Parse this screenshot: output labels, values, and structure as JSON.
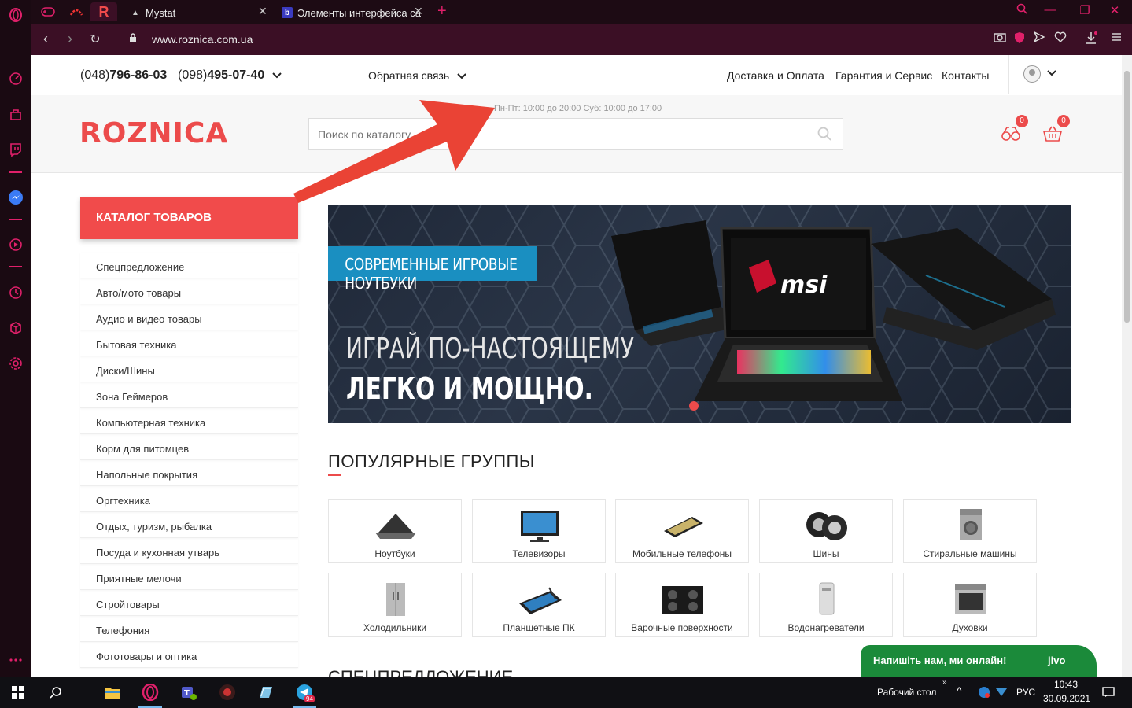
{
  "browser": {
    "tabs": [
      {
        "label": "Mystat"
      },
      {
        "label": "Элементы интерфейса са"
      }
    ],
    "new_tab": "+",
    "url": "www.roznica.com.ua",
    "active_pin": "R"
  },
  "site": {
    "phone1_code": "(048)",
    "phone1_num": "796-86-03",
    "phone2_code": "(098)",
    "phone2_num": "495-07-40",
    "feedback": "Обратная связь",
    "links": [
      "Доставка и Оплата",
      "Гарантия и Сервис",
      "Контакты"
    ],
    "logo": "ROZNICA",
    "hours": "Пн-Пт: 10:00 до 20:00 Суб: 10:00 до 17:00",
    "search_placeholder": "Поиск по каталогу",
    "compare_count": "0",
    "cart_count": "0",
    "catalog_button": "КАТАЛОГ ТОВАРОВ",
    "categories": [
      "Спецпредложение",
      "Авто/мото товары",
      "Аудио и видео товары",
      "Бытовая техника",
      "Диски/Шины",
      "Зона Геймеров",
      "Компьютерная техника",
      "Корм для питомцев",
      "Напольные покрытия",
      "Оргтехника",
      "Отдых, туризм, рыбалка",
      "Посуда и кухонная утварь",
      "Приятные мелочи",
      "Стройтовары",
      "Телефония",
      "Фототовары и оптика"
    ],
    "banner": {
      "ribbon": "СОВРЕМЕННЫЕ ИГРОВЫЕ НОУТБУКИ",
      "line1": "ИГРАЙ ПО-НАСТОЯЩЕМУ",
      "line2": "ЛЕГКО И МОЩНО.",
      "brand": "msi"
    },
    "popular_title": "ПОПУЛЯРНЫЕ ГРУППЫ",
    "groups": [
      "Ноутбуки",
      "Телевизоры",
      "Мобильные телефоны",
      "Шины",
      "Стиральные машины",
      "Холодильники",
      "Планшетные ПК",
      "Варочные поверхности",
      "Водонагреватели",
      "Духовки"
    ],
    "special_title": "СПЕЦПРЕДЛОЖЕНИЕ",
    "chat_text": "Напишіть нам, ми онлайн!",
    "chat_brand": "jivo"
  },
  "taskbar": {
    "desktop_label": "Рабочий стол",
    "lang": "РУС",
    "time": "10:43",
    "date": "30.09.2021",
    "telegram_badge": "94"
  },
  "colors": {
    "accent": "#ec4b4b",
    "opera": "#e0206a",
    "banner_ribbon": "#1a8fc1",
    "chat": "#1b8a3a"
  }
}
